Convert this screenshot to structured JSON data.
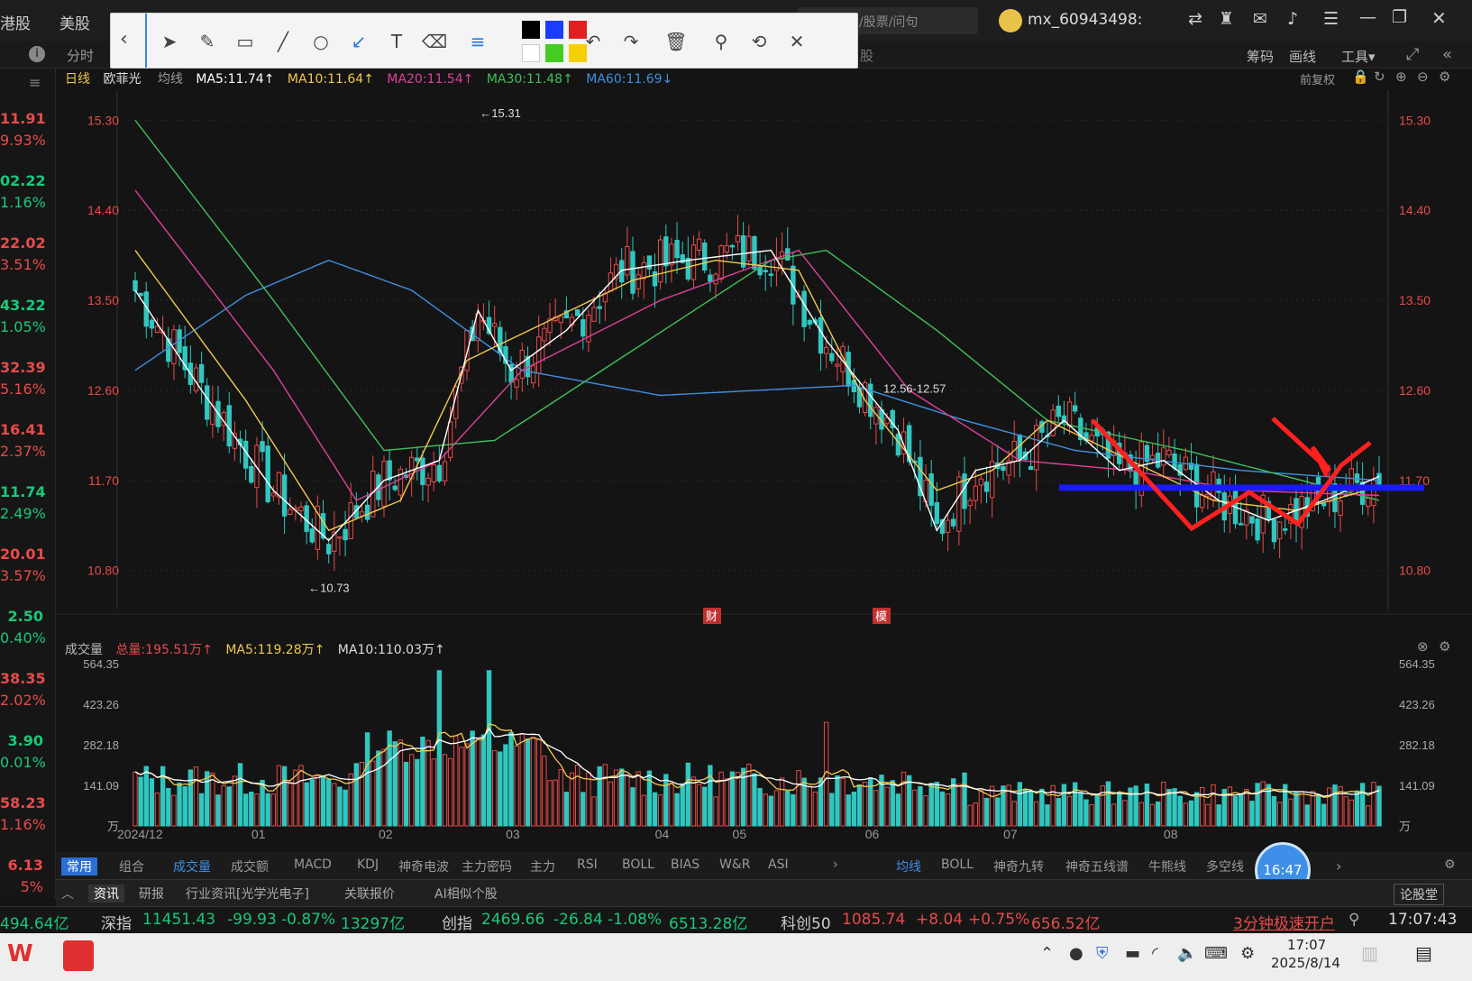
{
  "app": {
    "tabs": [
      "港股",
      "美股"
    ],
    "user": "mx_60943498:",
    "search_placeholder": "/股票/问句"
  },
  "subbar": {
    "left_tab": "分时",
    "right_items": [
      "筹码",
      "画线",
      "工具▾"
    ],
    "stock_suffix": "股"
  },
  "left_column": [
    {
      "price": "11.91",
      "pct": "9.93%",
      "color": "#e84a4a"
    },
    {
      "price": "02.22",
      "pct": "1.16%",
      "color": "#19c87a"
    },
    {
      "price": "22.02",
      "pct": "3.51%",
      "color": "#e84a4a"
    },
    {
      "price": "43.22",
      "pct": "1.05%",
      "color": "#19c87a"
    },
    {
      "price": "32.39",
      "pct": "5.16%",
      "color": "#e84a4a"
    },
    {
      "price": "16.41",
      "pct": "2.37%",
      "color": "#e84a4a"
    },
    {
      "price": "11.74",
      "pct": "2.49%",
      "color": "#19c87a"
    },
    {
      "price": "20.01",
      "pct": "3.57%",
      "color": "#e84a4a"
    },
    {
      "price": "2.50",
      "pct": "0.40%",
      "color": "#19c87a"
    },
    {
      "price": "38.35",
      "pct": "2.02%",
      "color": "#e84a4a"
    },
    {
      "price": "3.90",
      "pct": "0.01%",
      "color": "#19c87a"
    },
    {
      "price": "58.23",
      "pct": "1.16%",
      "color": "#e84a4a"
    },
    {
      "price": "6.13",
      "pct": "5%",
      "color": "#e84a4a"
    }
  ],
  "toolbar": {
    "icons": [
      "back-icon",
      "cursor-icon",
      "pen-icon",
      "rectangle-icon",
      "line-icon",
      "circle-icon",
      "arrow-icon",
      "text-icon",
      "eraser-icon",
      "line-width-icon",
      "undo-icon",
      "redo-icon",
      "delete-icon",
      "zoom-icon",
      "rotate-icon",
      "close-icon"
    ],
    "colors": [
      "#000000",
      "#1a3cff",
      "#e02020",
      "#ffffff",
      "#44cc22",
      "#f5d000"
    ]
  },
  "chart_header": {
    "period": "日线",
    "name": "欧菲光",
    "ma_label": "均线",
    "ma5": "MA5:11.74↑",
    "ma10": "MA10:11.64↑",
    "ma20": "MA20:11.54↑",
    "ma30": "MA30:11.48↑",
    "ma60": "MA60:11.69↓",
    "right_label": "前复权"
  },
  "volume_header": {
    "title": "成交量",
    "total": "总量:195.51万↑",
    "ma5": "MA5:119.28万↑",
    "ma10": "MA10:110.03万↑"
  },
  "markers": [
    "财",
    "模"
  ],
  "chart_data": [
    {
      "type": "candlestick",
      "title": "欧菲光 日线",
      "ylim": [
        10.5,
        15.6
      ],
      "y_ticks": [
        "15.30",
        "14.40",
        "13.50",
        "12.60",
        "11.70",
        "10.80"
      ],
      "x_ticks": [
        "2024/12",
        "01",
        "02",
        "03",
        "04",
        "05",
        "06",
        "07",
        "08"
      ],
      "annotations": [
        "15.31",
        "10.73",
        "12.56-12.57"
      ],
      "series": [
        {
          "name": "MA5",
          "color": "#ffffff"
        },
        {
          "name": "MA10",
          "color": "#f2c94c"
        },
        {
          "name": "MA20",
          "color": "#e0409a"
        },
        {
          "name": "MA30",
          "color": "#3fbf5a"
        },
        {
          "name": "MA60",
          "color": "#3f8fe0"
        }
      ],
      "anchors_ma60": [
        [
          0,
          12.8
        ],
        [
          20,
          13.55
        ],
        [
          35,
          13.9
        ],
        [
          50,
          13.6
        ],
        [
          70,
          12.8
        ],
        [
          95,
          12.55
        ],
        [
          130,
          12.65
        ],
        [
          150,
          12.3
        ],
        [
          170,
          12.0
        ],
        [
          200,
          11.8
        ],
        [
          225,
          11.7
        ]
      ],
      "anchors_ma30": [
        [
          0,
          15.3
        ],
        [
          25,
          13.5
        ],
        [
          45,
          12.0
        ],
        [
          65,
          12.1
        ],
        [
          90,
          13.0
        ],
        [
          115,
          13.9
        ],
        [
          125,
          14.0
        ],
        [
          145,
          13.2
        ],
        [
          165,
          12.3
        ],
        [
          190,
          12.0
        ],
        [
          225,
          11.5
        ]
      ],
      "anchors_ma20": [
        [
          0,
          14.6
        ],
        [
          25,
          12.8
        ],
        [
          40,
          11.5
        ],
        [
          55,
          11.9
        ],
        [
          70,
          12.8
        ],
        [
          95,
          13.5
        ],
        [
          120,
          14.0
        ],
        [
          140,
          12.6
        ],
        [
          160,
          11.9
        ],
        [
          180,
          11.8
        ],
        [
          200,
          11.6
        ],
        [
          225,
          11.55
        ]
      ],
      "anchors_ma10": [
        [
          0,
          14.0
        ],
        [
          20,
          12.5
        ],
        [
          35,
          11.2
        ],
        [
          48,
          11.5
        ],
        [
          60,
          12.9
        ],
        [
          75,
          13.3
        ],
        [
          90,
          13.7
        ],
        [
          105,
          13.9
        ],
        [
          120,
          13.8
        ],
        [
          132,
          12.5
        ],
        [
          145,
          11.6
        ],
        [
          155,
          11.8
        ],
        [
          165,
          12.3
        ],
        [
          180,
          11.9
        ],
        [
          195,
          11.5
        ],
        [
          210,
          11.4
        ],
        [
          225,
          11.64
        ]
      ],
      "anchors_ma5": [
        [
          0,
          13.6
        ],
        [
          12,
          12.6
        ],
        [
          25,
          11.6
        ],
        [
          35,
          11.1
        ],
        [
          45,
          11.7
        ],
        [
          55,
          11.9
        ],
        [
          62,
          13.4
        ],
        [
          68,
          12.8
        ],
        [
          78,
          13.2
        ],
        [
          88,
          13.8
        ],
        [
          100,
          13.9
        ],
        [
          115,
          14.0
        ],
        [
          125,
          13.1
        ],
        [
          138,
          12.2
        ],
        [
          145,
          11.2
        ],
        [
          152,
          11.8
        ],
        [
          160,
          11.9
        ],
        [
          168,
          12.3
        ],
        [
          178,
          11.8
        ],
        [
          186,
          11.9
        ],
        [
          196,
          11.5
        ],
        [
          205,
          11.3
        ],
        [
          215,
          11.5
        ],
        [
          225,
          11.74
        ]
      ]
    },
    {
      "type": "bar",
      "title": "成交量",
      "ylim": [
        0,
        564.35
      ],
      "y_ticks": [
        "564.35",
        "423.26",
        "282.18",
        "141.09",
        "万"
      ],
      "series": [
        {
          "name": "MA5",
          "color": "#f2c94c"
        },
        {
          "name": "MA10",
          "color": "#ffffff"
        }
      ]
    }
  ],
  "indicators_left": [
    "常用",
    "组合",
    "成交量",
    "成交额",
    "MACD",
    "KDJ",
    "神奇电波",
    "主力密码",
    "主力",
    "RSI",
    "BOLL",
    "BIAS",
    "W&R",
    "ASI"
  ],
  "indicators_right": [
    "均线",
    "BOLL",
    "神奇九转",
    "神奇五线谱",
    "牛熊线",
    "多空线"
  ],
  "clock_bubble": "16:47",
  "news_tabs": [
    "资讯",
    "研报",
    "行业资讯[光学光电子]",
    "关联报价",
    "AI相似个股"
  ],
  "news_right": "论股堂",
  "ticker": {
    "left": "494.64亿",
    "sz_name": "深指",
    "sz_val": "11451.43",
    "sz_chg": "-99.93",
    "sz_pct": "-0.87%",
    "sz_amt": "13297亿",
    "cy_name": "创指",
    "cy_val": "2469.66",
    "cy_chg": "-26.84",
    "cy_pct": "-1.08%",
    "cy_amt": "6513.28亿",
    "kc_name": "科创50",
    "kc_val": "1085.74",
    "kc_chg": "+8.04",
    "kc_pct": "+0.75%",
    "kc_amt": "656.52亿",
    "promo": "3分钟极速开户",
    "time": "17:07:43"
  },
  "taskbar": {
    "time": "17:07",
    "date": "2025/8/14"
  }
}
